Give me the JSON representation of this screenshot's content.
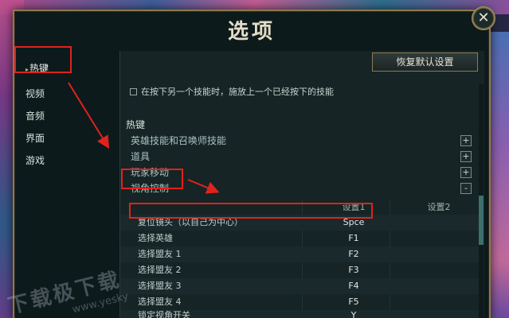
{
  "dialog": {
    "title": "选项",
    "close_symbol": "✕"
  },
  "sidebar": {
    "items": [
      {
        "label": "热键",
        "active": true
      },
      {
        "label": "视频",
        "active": false
      },
      {
        "label": "音频",
        "active": false
      },
      {
        "label": "界面",
        "active": false
      },
      {
        "label": "游戏",
        "active": false
      }
    ]
  },
  "content": {
    "reset_label": "恢复默认设置",
    "checkbox_label": "在按下另一个技能时，施放上一个已经按下的技能",
    "checkbox_checked": false,
    "section_title": "热键",
    "categories": [
      {
        "label": "英雄技能和召唤师技能",
        "toggle": "+"
      },
      {
        "label": "道具",
        "toggle": "+"
      },
      {
        "label": "玩家移动",
        "toggle": "+"
      },
      {
        "label": "视角控制",
        "toggle": "-"
      }
    ],
    "table": {
      "headers": [
        "设置1",
        "设置2"
      ],
      "rows": [
        {
          "action": "复位镜头（以自己为中心）",
          "key1": "Spce",
          "key2": ""
        },
        {
          "action": "选择英雄",
          "key1": "F1",
          "key2": ""
        },
        {
          "action": "选择盟友 1",
          "key1": "F2",
          "key2": ""
        },
        {
          "action": "选择盟友 2",
          "key1": "F3",
          "key2": ""
        },
        {
          "action": "选择盟友 3",
          "key1": "F4",
          "key2": ""
        },
        {
          "action": "选择盟友 4",
          "key1": "F5",
          "key2": ""
        },
        {
          "action": "锁定视角开关",
          "key1": "Y",
          "key2": ""
        }
      ]
    }
  },
  "watermark": {
    "text": "下载极下载",
    "url": "www.yesky"
  },
  "colors": {
    "annotation_red": "#e0221c",
    "gold_border": "#8e7a4a",
    "panel_bg": "#162426"
  }
}
